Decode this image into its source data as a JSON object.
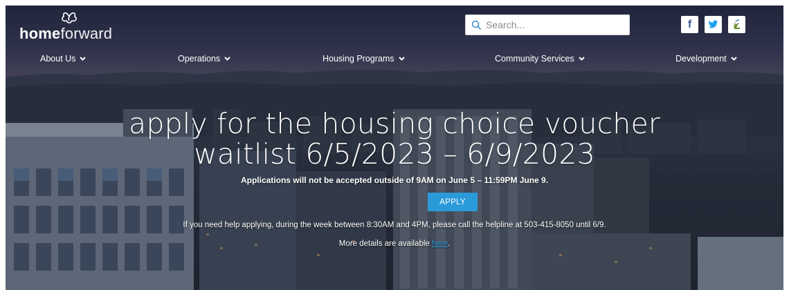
{
  "brand": {
    "name_bold": "home",
    "name_light": "forward"
  },
  "search": {
    "placeholder": "Search..."
  },
  "social": [
    {
      "label": "f",
      "icon": "facebook-icon"
    },
    {
      "label": "",
      "icon": "twitter-icon"
    },
    {
      "label": "",
      "icon": "accessibility-icon"
    }
  ],
  "nav": {
    "items": [
      {
        "label": "About Us"
      },
      {
        "label": "Operations"
      },
      {
        "label": "Housing Programs"
      },
      {
        "label": "Community Services"
      },
      {
        "label": "Development"
      }
    ]
  },
  "hero": {
    "headline_line1": "apply for the housing choice voucher",
    "headline_line2": "waitlist 6/5/2023 – 6/9/2023",
    "notice": "Applications will not be accepted outside of 9AM on June 5 – 11:59PM June 9.",
    "apply_label": "APPLY",
    "help_text": "If you need help applying, during the week between 8:30AM and 4PM, please call the helpline at 503-415-8050 until 6/9.",
    "more_prefix": "More details are available ",
    "more_link": "here",
    "more_suffix": "."
  },
  "colors": {
    "accent": "#2b9ad9",
    "facebook": "#3b5998",
    "twitter": "#1da1f2"
  }
}
